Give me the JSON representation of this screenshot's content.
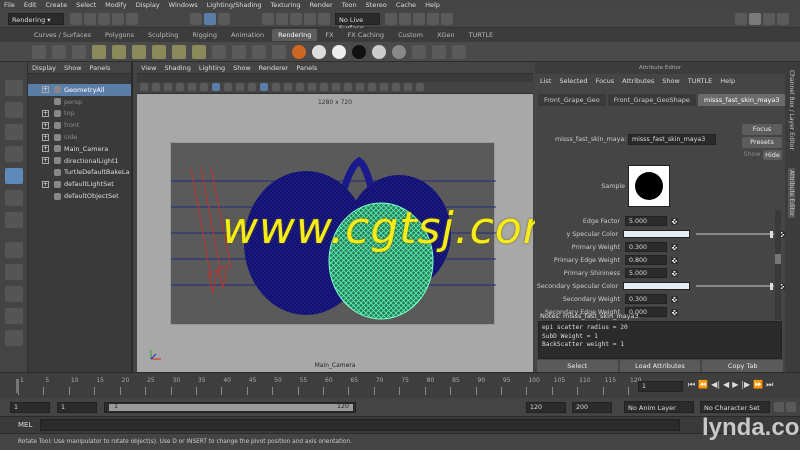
{
  "menubar": [
    "File",
    "Edit",
    "Create",
    "Select",
    "Modify",
    "Display",
    "Windows",
    "Lighting/Shading",
    "Texturing",
    "Render",
    "Toon",
    "Stereo",
    "Cache",
    "Help"
  ],
  "statusline": {
    "menuset": "Rendering",
    "render_view": "No Live Surface"
  },
  "shelf_tabs": [
    "Curves / Surfaces",
    "Polygons",
    "Sculpting",
    "Rigging",
    "Animation",
    "Rendering",
    "FX",
    "FX Caching",
    "Custom",
    "XGen",
    "TURTLE"
  ],
  "shelf_active": "Rendering",
  "outliner": {
    "menu": [
      "Display",
      "Show",
      "Panels"
    ],
    "items": [
      {
        "label": "GeometryAll",
        "selected": true,
        "expand": true
      },
      {
        "label": "persp",
        "dim": true,
        "expand": false
      },
      {
        "label": "top",
        "dim": true,
        "expand": true
      },
      {
        "label": "front",
        "dim": true,
        "expand": true
      },
      {
        "label": "side",
        "dim": true,
        "expand": true
      },
      {
        "label": "Main_Camera",
        "expand": true
      },
      {
        "label": "directionalLight1",
        "expand": true
      },
      {
        "label": "TurtleDefaultBakeLa",
        "expand": false
      },
      {
        "label": "defaultLightSet",
        "expand": true
      },
      {
        "label": "defaultObjectSet",
        "expand": false
      }
    ]
  },
  "viewport": {
    "menu": [
      "View",
      "Shading",
      "Lighting",
      "Show",
      "Renderer",
      "Panels"
    ],
    "resolution": "1280 x 720",
    "camera_label": "Main_Camera"
  },
  "attribute_editor": {
    "title": "Attribute Editor",
    "menu": [
      "List",
      "Selected",
      "Focus",
      "Attributes",
      "Show",
      "TURTLE",
      "Help"
    ],
    "tabs": [
      "Front_Grape_Geo",
      "Front_Grape_GeoShape",
      "misss_fast_skin_maya3"
    ],
    "active_tab": "misss_fast_skin_maya3",
    "node_label": "misss_fast_skin_maya:",
    "node_name": "misss_fast_skin_maya3",
    "focus_btn": "Focus",
    "presets_btn": "Presets",
    "show_btn": "Show",
    "hide_btn": "Hide",
    "sample_label": "Sample",
    "attrs": [
      {
        "label": "Edge Factor",
        "value": "5.000",
        "type": "num"
      },
      {
        "label": "y Specular Color",
        "value": "",
        "type": "color",
        "knob": 0.95
      },
      {
        "label": "Primary Weight",
        "value": "0.300",
        "type": "num"
      },
      {
        "label": "Primary Edge Weight",
        "value": "0.800",
        "type": "num"
      },
      {
        "label": "Primary Shininess",
        "value": "5.000",
        "type": "num"
      },
      {
        "label": "Secondary Specular Color",
        "value": "",
        "type": "color",
        "knob": 0.95
      },
      {
        "label": "Secondary Weight",
        "value": "0.300",
        "type": "num"
      },
      {
        "label": "Secondary Edge Weight",
        "value": "0.000",
        "type": "num"
      }
    ],
    "notes_label": "Notes:  misss_fast_skin_maya3",
    "notes_lines": [
      "epi scatter radius = 20",
      "SubD Weight = 1",
      "BackScatter weight = 1"
    ],
    "buttons": [
      "Select",
      "Load Attributes",
      "Copy Tab"
    ]
  },
  "side_tabs": [
    "Channel Box / Layer Editor",
    "Attribute Editor"
  ],
  "timeslider": {
    "ticks": [
      "1",
      "5",
      "10",
      "15",
      "20",
      "25",
      "30",
      "35",
      "40",
      "45",
      "50",
      "55",
      "60",
      "65",
      "70",
      "75",
      "80",
      "85",
      "90",
      "95",
      "100",
      "105",
      "110",
      "115",
      "120"
    ],
    "current": "1"
  },
  "range": {
    "start": "1",
    "playback_start": "1",
    "range_start_label": "1",
    "range_end_label": "120",
    "playback_end": "120",
    "end": "200",
    "anim_layer": "No Anim Layer",
    "character_set": "No Character Set"
  },
  "cmdline": {
    "label": "MEL"
  },
  "helpline": "Rotate Tool: Use manipulator to rotate object(s). Use D or INSERT to change the pivot position and axis orientation.",
  "watermark": "www.cgtsj.com",
  "brand": "lynda.com",
  "colors": {
    "accent": "#5b7ea8",
    "mesh_blue": "#1a1a8c",
    "mesh_green": "#3cf0a0",
    "watermark": "#f5ec1a"
  }
}
